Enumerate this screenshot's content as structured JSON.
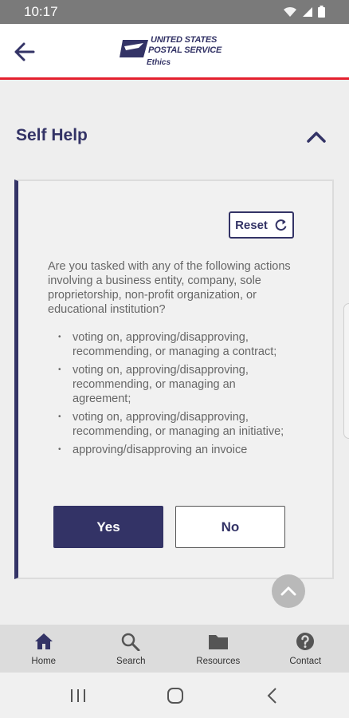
{
  "status_bar": {
    "time": "10:17"
  },
  "header": {
    "logo_line1": "UNITED STATES",
    "logo_line2": "POSTAL SERVICE",
    "logo_sub": "Ethics"
  },
  "section": {
    "title": "Self Help"
  },
  "card": {
    "reset_label": "Reset",
    "question": "Are you tasked with any of the following actions involving a business entity, company, sole proprietorship, non-profit organization, or educational institution?",
    "bullet": "•",
    "options": [
      "voting on, approving/disapproving, recommending, or managing a contract;",
      "voting on, approving/disapproving, recommending, or managing an agreement;",
      "voting on, approving/disapproving, recommending, or managing an initiative;",
      "approving/disapproving an invoice"
    ],
    "yes_label": "Yes",
    "no_label": "No"
  },
  "bottom_nav": {
    "items": [
      {
        "label": "Home",
        "icon": "home-icon"
      },
      {
        "label": "Search",
        "icon": "search-icon"
      },
      {
        "label": "Resources",
        "icon": "folder-icon"
      },
      {
        "label": "Contact",
        "icon": "help-icon"
      }
    ]
  },
  "colors": {
    "primary": "#333366",
    "accent_red": "#e4202e",
    "status_bar": "#7a7a7a",
    "background": "#eeeeee"
  }
}
